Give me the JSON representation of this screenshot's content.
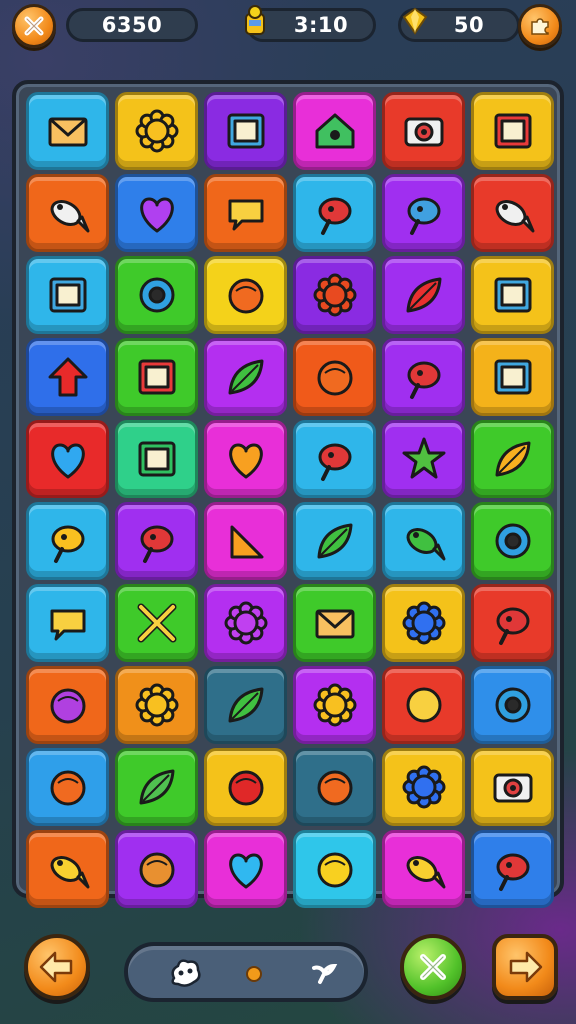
{
  "topbar": {
    "score": "6350",
    "timer": "3:10",
    "coins": "50",
    "close_icon": "close-x-icon",
    "timer_icon": "trophy-character-icon",
    "coin_icon": "gold-gem-icon",
    "puzzle_icon": "puzzle-piece-icon"
  },
  "board": {
    "rows": [
      [
        {
          "color": "#2fb6ea",
          "icon": "envelope-icon"
        },
        {
          "color": "#f4c21a",
          "icon": "sun-gear-icon"
        },
        {
          "color": "#8a2be2",
          "icon": "picture-frame-icon"
        },
        {
          "color": "#e82fd8",
          "icon": "green-house-icon"
        },
        {
          "color": "#e83a2a",
          "icon": "camera-icon"
        },
        {
          "color": "#f4c21a",
          "icon": "flag-box-icon"
        }
      ],
      [
        {
          "color": "#f0671a",
          "icon": "fish-icon"
        },
        {
          "color": "#2f7fea",
          "icon": "purple-heart-icon"
        },
        {
          "color": "#f0671a",
          "icon": "speech-bubble-icon"
        },
        {
          "color": "#2fb6ea",
          "icon": "pinwheel-icon"
        },
        {
          "color": "#a02ff0",
          "icon": "hammer-icon"
        },
        {
          "color": "#e83a2a",
          "icon": "fish-icon"
        }
      ],
      [
        {
          "color": "#2fb6ea",
          "icon": "card-icon"
        },
        {
          "color": "#3fca2a",
          "icon": "ring-target-icon"
        },
        {
          "color": "#f4d21a",
          "icon": "shell-icon"
        },
        {
          "color": "#8a2be2",
          "icon": "red-flower-icon"
        },
        {
          "color": "#a02ff0",
          "icon": "red-leaf-icon"
        },
        {
          "color": "#f4c21a",
          "icon": "folder-icon"
        }
      ],
      [
        {
          "color": "#2f6fea",
          "icon": "red-arrow-up-icon"
        },
        {
          "color": "#3fca2a",
          "icon": "flag-icon"
        },
        {
          "color": "#b42ff0",
          "icon": "green-leaf-icon"
        },
        {
          "color": "#f05a1a",
          "icon": "orange-ball-icon"
        },
        {
          "color": "#a02ff0",
          "icon": "bird-icon"
        },
        {
          "color": "#f4b21a",
          "icon": "photo-frame-icon"
        }
      ],
      [
        {
          "color": "#e82a2a",
          "icon": "blue-heart-icon"
        },
        {
          "color": "#2fd08a",
          "icon": "checkbox-icon"
        },
        {
          "color": "#e82fd8",
          "icon": "orange-heart-icon"
        },
        {
          "color": "#2fb6ea",
          "icon": "red-tag-icon"
        },
        {
          "color": "#a02ff0",
          "icon": "green-star-icon"
        },
        {
          "color": "#3fca2a",
          "icon": "pencil-icon"
        }
      ],
      [
        {
          "color": "#2fb6ea",
          "icon": "yellow-bird-icon"
        },
        {
          "color": "#a02ff0",
          "icon": "rocket-icon"
        },
        {
          "color": "#e82fd8",
          "icon": "triangle-icon"
        },
        {
          "color": "#2fb6ea",
          "icon": "fern-icon"
        },
        {
          "color": "#2fb6ea",
          "icon": "green-fish-icon"
        },
        {
          "color": "#3fca2a",
          "icon": "blue-ring-icon"
        }
      ],
      [
        {
          "color": "#2fb6ea",
          "icon": "chat-bubble-icon"
        },
        {
          "color": "#3fca2a",
          "icon": "crossed-swords-icon"
        },
        {
          "color": "#b42ff0",
          "icon": "virus-icon"
        },
        {
          "color": "#3fca2a",
          "icon": "mail-icon"
        },
        {
          "color": "#f4c21a",
          "icon": "blue-gear-icon"
        },
        {
          "color": "#e83a2a",
          "icon": "red-pin-icon"
        }
      ],
      [
        {
          "color": "#f0671a",
          "icon": "purple-blob-icon"
        },
        {
          "color": "#f0901a",
          "icon": "smiling-sun-icon"
        },
        {
          "color": "#2f6f8a",
          "icon": "green-pill-icon"
        },
        {
          "color": "#b42ff0",
          "icon": "sun-badge-icon"
        },
        {
          "color": "#e83a2a",
          "icon": "yellow-shoe-icon"
        },
        {
          "color": "#2f8fea",
          "icon": "donut-icon"
        }
      ],
      [
        {
          "color": "#2f9fea",
          "icon": "shell-orange-icon"
        },
        {
          "color": "#3fca2a",
          "icon": "paper-plane-icon"
        },
        {
          "color": "#f4c21a",
          "icon": "red-rose-icon"
        },
        {
          "color": "#2f6f8a",
          "icon": "green-orange-ball-icon"
        },
        {
          "color": "#f4c21a",
          "icon": "blue-flower-icon"
        },
        {
          "color": "#f4c21a",
          "icon": "robot-box-icon"
        }
      ],
      [
        {
          "color": "#f0671a",
          "icon": "yellow-fish-head-icon"
        },
        {
          "color": "#a02ff0",
          "icon": "cookie-icon"
        },
        {
          "color": "#e82fd8",
          "icon": "cyan-heart-icon"
        },
        {
          "color": "#2fc6ea",
          "icon": "lemon-icon"
        },
        {
          "color": "#e82fd8",
          "icon": "yellow-fish-icon"
        },
        {
          "color": "#2f7fea",
          "icon": "red-stamp-icon"
        }
      ]
    ]
  },
  "bottom": {
    "back_icon": "arrow-left-icon",
    "cancel_icon": "x-icon",
    "next_icon": "arrow-right-icon",
    "tray_icons": [
      "gear-blob-icon",
      "orange-dot-icon",
      "sprout-icon"
    ]
  }
}
